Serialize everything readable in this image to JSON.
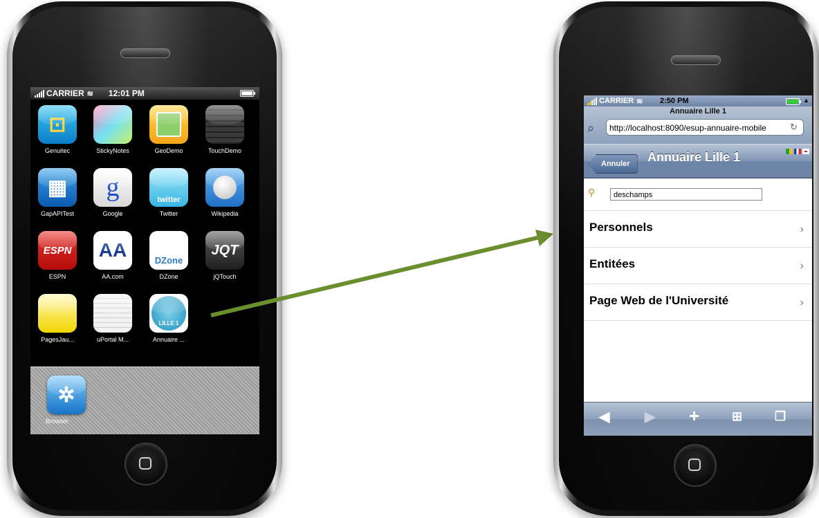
{
  "left_phone": {
    "status": {
      "carrier": "CARRIER",
      "time": "12:01 PM"
    },
    "apps": [
      {
        "label": "Genuitec",
        "icon": "genuitec-icon"
      },
      {
        "label": "StickyNotes",
        "icon": "stickynotes-icon"
      },
      {
        "label": "GeoDemo",
        "icon": "geodemo-icon"
      },
      {
        "label": "TouchDemo",
        "icon": "touchdemo-icon"
      },
      {
        "label": "GapAPITest",
        "icon": "gapapitest-icon"
      },
      {
        "label": "Google",
        "icon": "google-icon",
        "glyph": "g"
      },
      {
        "label": "Twitter",
        "icon": "twitter-icon",
        "glyph": "twitter"
      },
      {
        "label": "Wikipedia",
        "icon": "wikipedia-icon"
      },
      {
        "label": "ESPN",
        "icon": "espn-icon",
        "glyph": "ESPN"
      },
      {
        "label": "AA.com",
        "icon": "aa-icon",
        "glyph": "AA"
      },
      {
        "label": "DZone",
        "icon": "dzone-icon",
        "glyph": "DZone"
      },
      {
        "label": "jQTouch",
        "icon": "jqtouch-icon",
        "glyph": "JQT"
      },
      {
        "label": "PagesJau...",
        "icon": "pagesjaunes-icon"
      },
      {
        "label": "uPortal M...",
        "icon": "uportal-icon"
      },
      {
        "label": "Annuaire ...",
        "icon": "annuaire-icon",
        "glyph": "LILLE 1"
      }
    ],
    "dock": [
      {
        "label": "Browser",
        "icon": "browser-icon"
      }
    ]
  },
  "right_phone": {
    "status": {
      "carrier": "CARRIER",
      "time": "2:50 PM"
    },
    "page_title": "Annuaire Lille 1",
    "url": "http://localhost:8090/esup-annuaire-mobile",
    "nav": {
      "back_label": "Annuler",
      "title": "Annuaire Lille 1"
    },
    "search": {
      "value": "deschamps"
    },
    "items": [
      {
        "label": "Personnels"
      },
      {
        "label": "Entitées"
      },
      {
        "label": "Page Web de l'Université"
      }
    ],
    "toolbar": [
      "back-icon",
      "forward-icon",
      "add-icon",
      "bookmarks-icon",
      "pages-icon"
    ]
  },
  "colors": {
    "arrow": "#6b8e2f",
    "nav_blue": "#6d84a6"
  }
}
